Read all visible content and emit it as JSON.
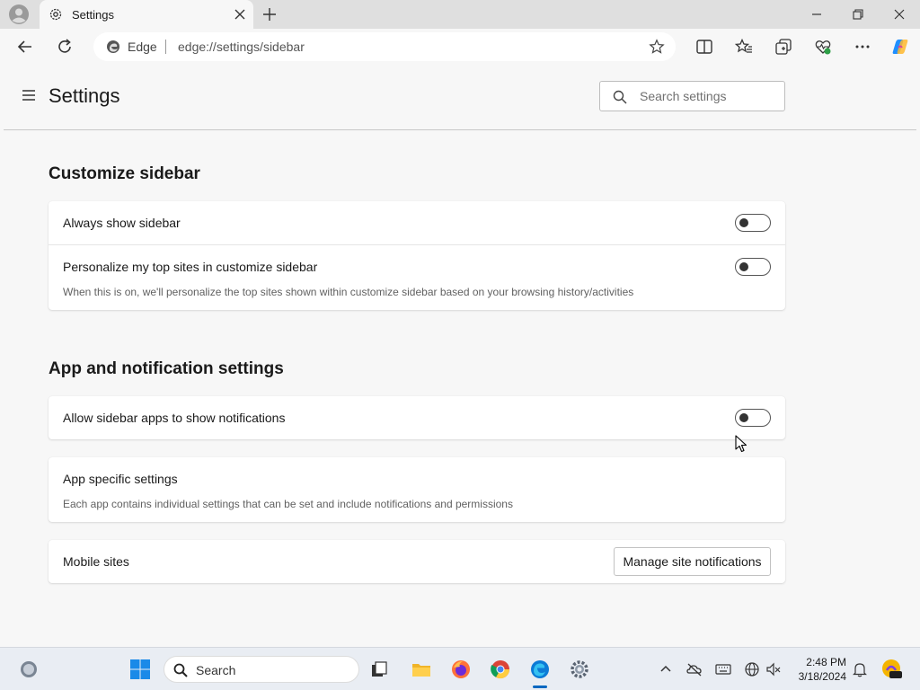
{
  "browser": {
    "tab_title": "Settings",
    "omnibox_label": "Edge",
    "url": "edge://settings/sidebar"
  },
  "settings": {
    "title": "Settings",
    "search_placeholder": "Search settings"
  },
  "sections": {
    "customize": {
      "title": "Customize sidebar",
      "always_show": {
        "label": "Always show sidebar",
        "enabled": false
      },
      "personalize": {
        "label": "Personalize my top sites in customize sidebar",
        "description": "When this is on, we'll personalize the top sites shown within customize sidebar based on your browsing history/activities",
        "enabled": false
      }
    },
    "app_notifications": {
      "title": "App and notification settings",
      "allow_notifications": {
        "label": "Allow sidebar apps to show notifications",
        "enabled": false
      },
      "app_specific": {
        "label": "App specific settings",
        "description": "Each app contains individual settings that can be set and include notifications and permissions"
      },
      "mobile_sites": {
        "label": "Mobile sites",
        "button_label": "Manage site notifications"
      }
    }
  },
  "taskbar": {
    "search_label": "Search",
    "time": "2:48 PM",
    "date": "3/18/2024"
  },
  "colors": {
    "accent": "#0067c0",
    "page_bg": "#f7f7f7",
    "card_bg": "#ffffff"
  }
}
